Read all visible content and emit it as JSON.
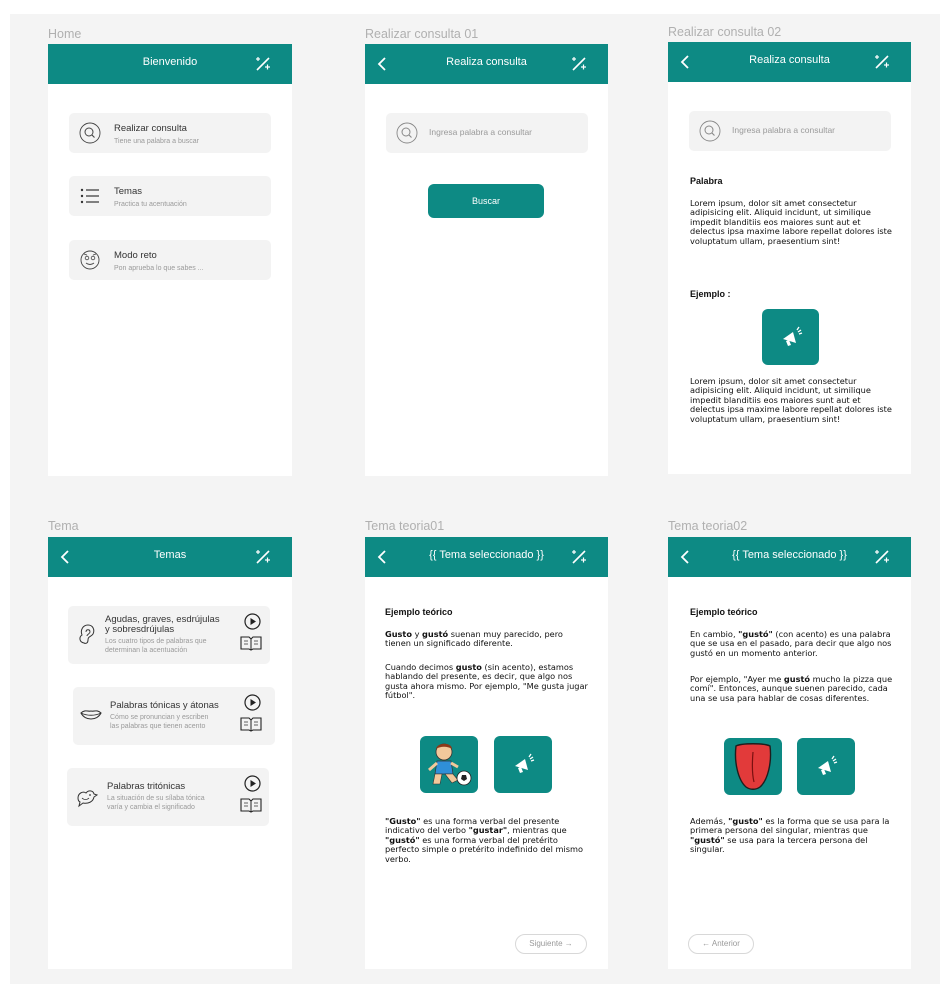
{
  "colors": {
    "primary": "#0d8a84",
    "canvas": "#f4f4f4",
    "card": "#f3f3f3",
    "muted": "#9a9a9a"
  },
  "labels": {
    "home": "Home",
    "consulta01": "Realizar consulta 01",
    "consulta02": "Realizar consulta 02",
    "tema": "Tema",
    "teoria01": "Tema teoria01",
    "teoria02": "Tema teoria02"
  },
  "home": {
    "title": "Bienvenido",
    "items": [
      {
        "title": "Realizar consulta",
        "subtitle": "Tiene una palabra a buscar",
        "icon": "search-icon"
      },
      {
        "title": "Temas",
        "subtitle": "Practica tu acentuación",
        "icon": "list-icon"
      },
      {
        "title": "Modo reto",
        "subtitle": "Pon aprueba lo que sabes ...",
        "icon": "face-icon"
      }
    ]
  },
  "consulta": {
    "title": "Realiza consulta",
    "placeholder": "Ingresa palabra a consultar",
    "button": "Buscar",
    "word_heading": "Palabra",
    "paragraph1": "Lorem ipsum, dolor sit amet consectetur adipisicing elit. Aliquid incidunt, ut similique impedit blanditiis eos maiores sunt aut et delectus ipsa maxime labore repellat dolores iste voluptatum ullam, praesentium sint!",
    "example_heading": "Ejemplo :",
    "paragraph2": "Lorem ipsum, dolor sit amet consectetur adipisicing elit. Aliquid incidunt, ut similique impedit blanditiis eos maiores sunt aut et delectus ipsa maxime labore repellat dolores iste voluptatum ullam, praesentium sint!"
  },
  "tema": {
    "title": "Temas",
    "items": [
      {
        "title1": "Agudas, graves, esdrújulas",
        "title2": "y sobresdrújulas",
        "sub1": "Los cuatro tipos de palabras que",
        "sub2": "determinan la acentuación"
      },
      {
        "title1": "Palabras tónicas y átonas",
        "title2": "",
        "sub1": "Cómo se pronuncian y escriben",
        "sub2": "las palabras que tienen acento"
      },
      {
        "title1": "Palabras tritónicas",
        "title2": "",
        "sub1": "La situación de su sílaba tónica",
        "sub2": "varía y cambia el significado"
      }
    ]
  },
  "teoria": {
    "title": "{{ Tema seleccionado }}",
    "heading": "Ejemplo teórico",
    "t1": {
      "p1": [
        {
          "t": "Gusto",
          "b": true
        },
        {
          "t": " y ",
          "b": false
        },
        {
          "t": "gustó",
          "b": true
        },
        {
          "t": " suenan muy parecido, pero tienen un significado diferente.",
          "b": false
        }
      ],
      "p2": [
        {
          "t": "Cuando decimos ",
          "b": false
        },
        {
          "t": "gusto",
          "b": true
        },
        {
          "t": " (sin acento), estamos hablando del presente, es decir, que algo nos gusta ahora mismo. Por ejemplo, \"Me gusta jugar fútbol\".",
          "b": false
        }
      ],
      "p3": [
        {
          "t": "\"Gusto\"",
          "b": true
        },
        {
          "t": " es una forma verbal del presente indicativo del verbo ",
          "b": false
        },
        {
          "t": "\"gustar\"",
          "b": true
        },
        {
          "t": ", mientras que ",
          "b": false
        },
        {
          "t": "\"gustó\"",
          "b": true
        },
        {
          "t": " es una forma verbal del pretérito perfecto simple o pretérito indefinido del mismo verbo.",
          "b": false
        }
      ],
      "next": "Siguiente"
    },
    "t2": {
      "p1": [
        {
          "t": "En cambio, ",
          "b": false
        },
        {
          "t": "\"gustó\"",
          "b": true
        },
        {
          "t": " (con acento) es una palabra que se usa en el pasado, para decir que algo nos gustó en un momento anterior.",
          "b": false
        }
      ],
      "p2": [
        {
          "t": "Por ejemplo, \"Ayer me ",
          "b": false
        },
        {
          "t": "gustó",
          "b": true
        },
        {
          "t": " mucho la pizza que comí\". Entonces, aunque suenen parecido, cada una se usa para hablar de cosas diferentes.",
          "b": false
        }
      ],
      "p3": [
        {
          "t": "Además, ",
          "b": false
        },
        {
          "t": "\"gusto\"",
          "b": true
        },
        {
          "t": " es la forma que se usa para la primera persona del singular, mientras que ",
          "b": false
        },
        {
          "t": "\"gustó\"",
          "b": true
        },
        {
          "t": " se usa para la tercera persona del singular.",
          "b": false
        }
      ],
      "prev": "Anterior"
    }
  }
}
